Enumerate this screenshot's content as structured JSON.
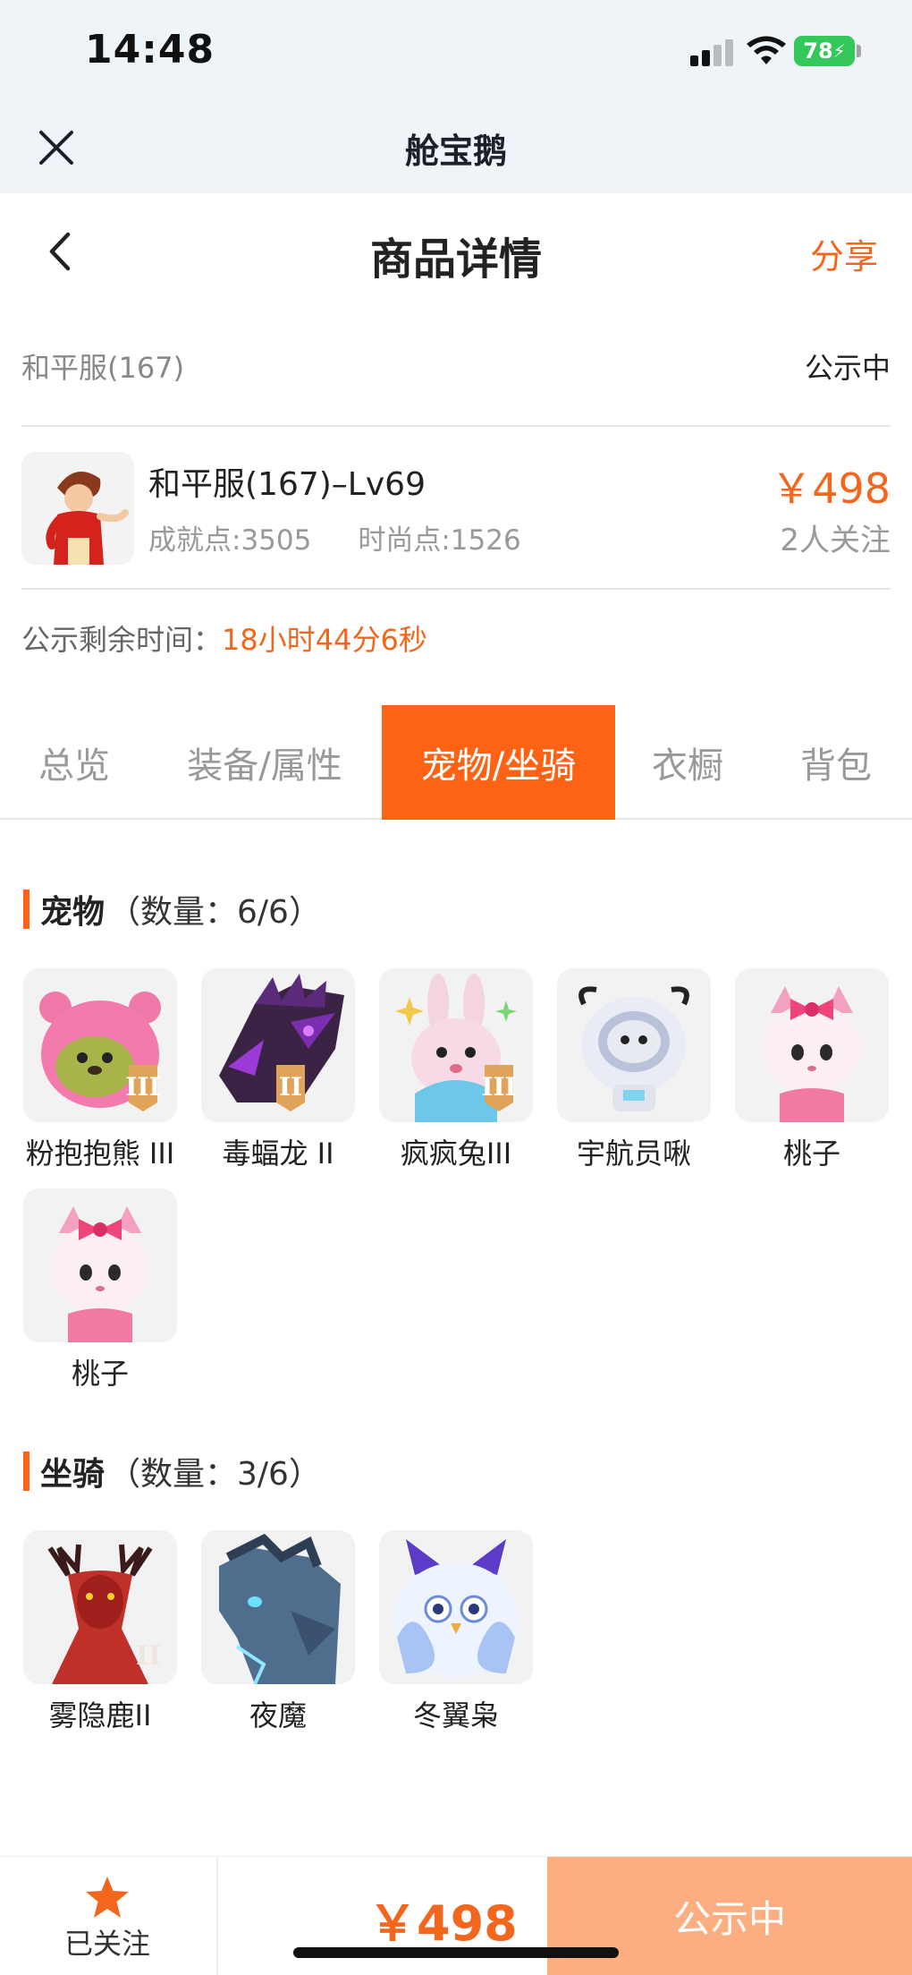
{
  "status_bar": {
    "time": "14:48",
    "battery": "78"
  },
  "app_bar": {
    "title": "舱宝鹅"
  },
  "header": {
    "title": "商品详情",
    "share_label": "分享"
  },
  "server": {
    "name": "和平服(167)",
    "status": "公示中"
  },
  "product": {
    "title": "和平服(167)–Lv69",
    "achievement_points": "成就点:3505",
    "fashion_points": "时尚点:1526",
    "price": "￥498",
    "followers": "2人关注"
  },
  "remaining": {
    "label": "公示剩余时间：",
    "value": "18小时44分6秒"
  },
  "tabs": [
    {
      "label": "总览",
      "active": false
    },
    {
      "label": "装备/属性",
      "active": false
    },
    {
      "label": "宠物/坐骑",
      "active": true
    },
    {
      "label": "衣橱",
      "active": false
    },
    {
      "label": "背包",
      "active": false
    }
  ],
  "pets": {
    "title": "宠物",
    "count": "（数量：6/6）",
    "items": [
      {
        "name": "粉抱抱熊 III",
        "icon": "pink-bear-pet-icon"
      },
      {
        "name": "毒蝠龙 II",
        "icon": "poison-dragon-pet-icon"
      },
      {
        "name": "疯疯兔III",
        "icon": "crazy-rabbit-pet-icon"
      },
      {
        "name": "宇航员啾",
        "icon": "astronaut-pet-icon"
      },
      {
        "name": "桃子",
        "icon": "peach-cat-pet-icon"
      },
      {
        "name": "桃子",
        "icon": "peach-cat-pet-icon"
      }
    ]
  },
  "mounts": {
    "title": "坐骑",
    "count": "（数量：3/6）",
    "items": [
      {
        "name": "雾隐鹿II",
        "icon": "mist-deer-mount-icon"
      },
      {
        "name": "夜魔",
        "icon": "night-demon-mount-icon"
      },
      {
        "name": "冬翼枭",
        "icon": "winter-owl-mount-icon"
      }
    ]
  },
  "bottom_bar": {
    "follow_label": "已关注",
    "price": "￥498",
    "status_label": "公示中"
  },
  "colors": {
    "accent": "#fe6214",
    "price": "#f2661d",
    "status_button": "#fcae80"
  }
}
